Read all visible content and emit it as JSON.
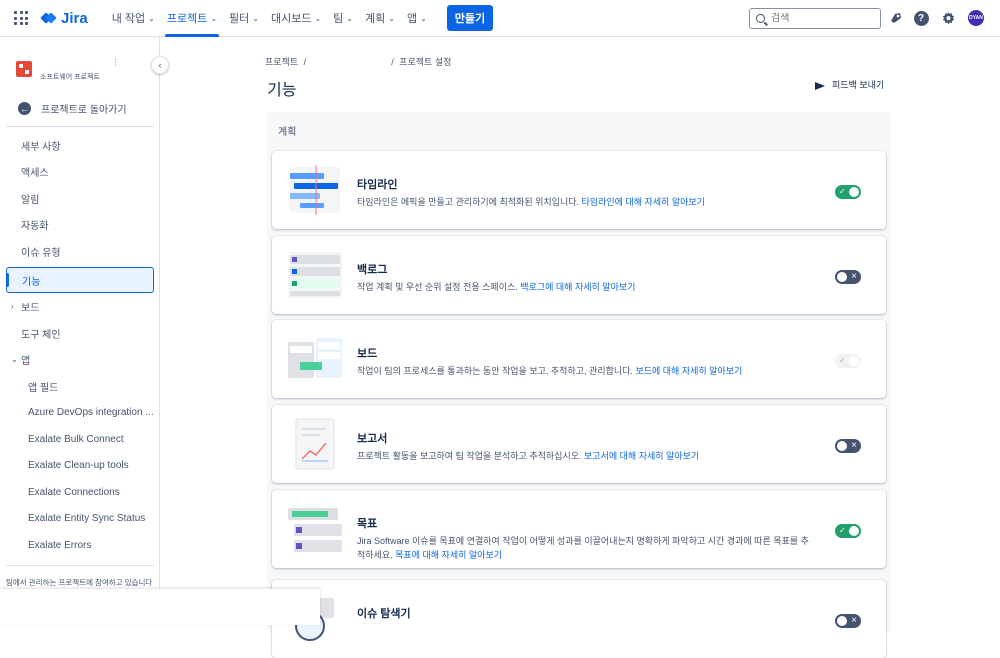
{
  "colors": {
    "brand": "#0c66e4",
    "toggle_on": "#22a06b",
    "toggle_off": "#44546f",
    "project_icon": "#e5493a"
  },
  "topnav": {
    "logo": "Jira",
    "items": [
      {
        "label": "내 작업",
        "icon": "chevron-down-icon"
      },
      {
        "label": "프로젝트",
        "icon": "chevron-down-icon",
        "active": true
      },
      {
        "label": "필터",
        "icon": "chevron-down-icon"
      },
      {
        "label": "대시보드",
        "icon": "chevron-down-icon"
      },
      {
        "label": "팀",
        "icon": "chevron-down-icon"
      },
      {
        "label": "계획",
        "icon": "chevron-down-icon"
      },
      {
        "label": "앱",
        "icon": "chevron-down-icon"
      }
    ],
    "create_label": "만들기",
    "search_placeholder": "검색",
    "avatar_initials": "DYAN"
  },
  "sidebar": {
    "project_type": "소프트웨어 프로젝트",
    "back_label": "프로젝트로 돌아가기",
    "items": [
      {
        "label": "세부 사항"
      },
      {
        "label": "액세스"
      },
      {
        "label": "알림"
      },
      {
        "label": "자동화"
      },
      {
        "label": "이슈 유형"
      },
      {
        "label": "기능",
        "selected": true
      },
      {
        "label": "보드",
        "expand": "collapsed"
      },
      {
        "label": "도구 체인"
      },
      {
        "label": "앱",
        "expand": "expanded"
      }
    ],
    "app_items": [
      {
        "label": "앱 필드"
      },
      {
        "label": "Azure DevOps integration ..."
      },
      {
        "label": "Exalate Bulk Connect"
      },
      {
        "label": "Exalate Clean-up tools"
      },
      {
        "label": "Exalate Connections"
      },
      {
        "label": "Exalate Entity Sync Status"
      },
      {
        "label": "Exalate Errors"
      }
    ],
    "footer": "팀에서 관리하는 프로젝트에 참여하고 있습니다"
  },
  "main": {
    "breadcrumb": [
      "프로젝트",
      "/",
      "",
      "/",
      "프로젝트 설정"
    ],
    "title": "기능",
    "feedback_label": "피드백 보내기",
    "section_title": "계획",
    "features": [
      {
        "title": "타임라인",
        "desc": "타임라인은 에픽을 만들고 관리하기에 최적화된 위치입니다.",
        "link": "타임라인에 대해 자세히 알아보기",
        "state": "on"
      },
      {
        "title": "백로그",
        "desc": "작업 계획 및 우선 순위 설정 전용 스페이스.",
        "link": "백로그에 대해 자세히 알아보기",
        "state": "off"
      },
      {
        "title": "보드",
        "desc": "작업이 팀의 프로세스를 통과하는 동안 작업을 보고, 추적하고, 관리합니다.",
        "link": "보드에 대해 자세히 알아보기",
        "state": "disabled"
      },
      {
        "title": "보고서",
        "desc": "프로젝트 활동을 보고하여 팀 작업을 분석하고 추적하십시오.",
        "link": "보고서에 대해 자세히 알아보기",
        "state": "off"
      },
      {
        "title": "목표",
        "desc": "Jira Software 이슈를 목표에 연결하여 작업이 어떻게 성과를 이끌어내는지 명확하게 파악하고 시간 경과에 따른 목표를 추적하세요.",
        "link": "목표에 대해 자세히 알아보기",
        "state": "on"
      },
      {
        "title": "이슈 탐색기",
        "desc": "",
        "link": "",
        "state": "off"
      }
    ]
  }
}
